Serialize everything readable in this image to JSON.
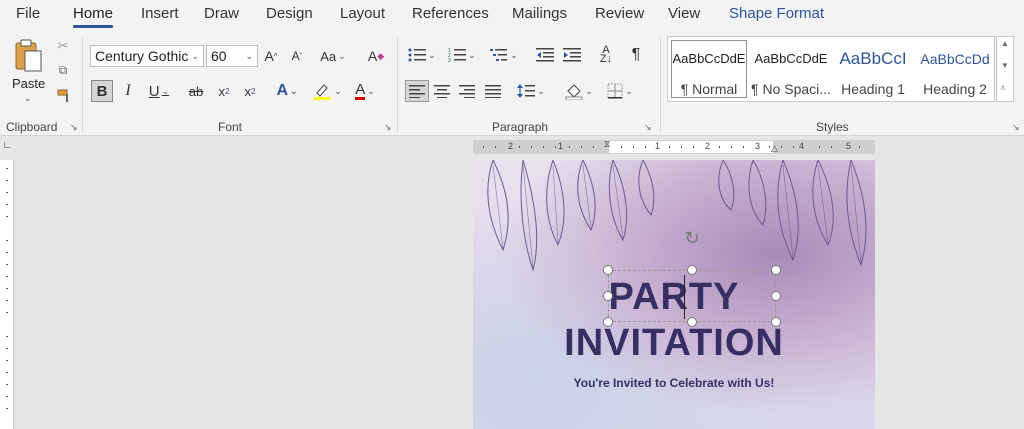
{
  "tabs": [
    "File",
    "Home",
    "Insert",
    "Draw",
    "Design",
    "Layout",
    "References",
    "Mailings",
    "Review",
    "View",
    "Shape Format"
  ],
  "clipboard": {
    "paste_label": "Paste",
    "group_label": "Clipboard"
  },
  "font": {
    "family": "Century Gothic",
    "size": "60",
    "group_label": "Font",
    "change_case": "Aa"
  },
  "paragraph": {
    "group_label": "Paragraph"
  },
  "styles": {
    "group_label": "Styles",
    "items": [
      {
        "sample": "AaBbCcDdE",
        "name": "¶ Normal"
      },
      {
        "sample": "AaBbCcDdE",
        "name": "¶ No Spaci..."
      },
      {
        "sample": "AaBbCcI",
        "name": "Heading 1"
      },
      {
        "sample": "AaBbCcDd",
        "name": "Heading 2"
      }
    ]
  },
  "document": {
    "title_line1": "PARTY",
    "title_line2": "INVITATION",
    "subtitle": "You're Invited to Celebrate with Us!"
  },
  "ruler": {
    "numbers": [
      "2",
      "1",
      "1",
      "2",
      "3",
      "4",
      "5"
    ]
  },
  "colors": {
    "accent": "#2b579a",
    "title": "#372f63",
    "highlight": "#ffff00",
    "font_color": "#e00000"
  }
}
